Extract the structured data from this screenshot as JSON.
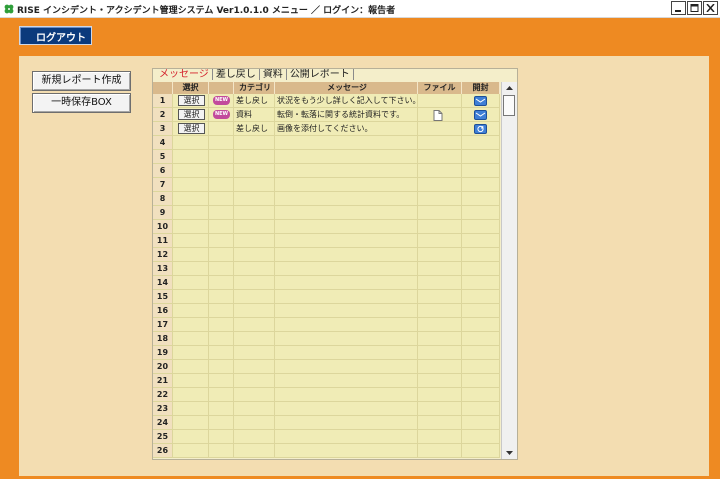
{
  "window": {
    "title": "RISE インシデント・アクシデント管理システム Ver1.0.1.0 メニュー ／ ログイン：報告者"
  },
  "toolbar": {
    "logout_label": "ログアウト"
  },
  "sidebar": {
    "new_report_label": "新規レポート作成",
    "temp_box_label": "一時保存BOX"
  },
  "tabs": [
    {
      "label": "メッセージ",
      "active": true
    },
    {
      "label": "差し戻し",
      "active": false
    },
    {
      "label": "資料",
      "active": false
    },
    {
      "label": "公開レポート",
      "active": false
    }
  ],
  "table": {
    "headers": [
      "",
      "選択",
      "",
      "カテゴリ",
      "メッセージ",
      "ファイル",
      "開封"
    ],
    "select_label": "選択",
    "new_badge": "NEW",
    "rows": [
      {
        "num": "1",
        "new": true,
        "category": "差し戻し",
        "message": "状況をもう少し詳しく記入して下さい。",
        "file": false,
        "check": "mail-opened"
      },
      {
        "num": "2",
        "new": true,
        "category": "資料",
        "message": "転倒・転落に関する統計資料です。",
        "file": true,
        "check": "mail-opened"
      },
      {
        "num": "3",
        "new": false,
        "category": "差し戻し",
        "message": "画像を添付してください。",
        "file": false,
        "check": "refresh"
      },
      {
        "num": "4"
      },
      {
        "num": "5"
      },
      {
        "num": "6"
      },
      {
        "num": "7"
      },
      {
        "num": "8"
      },
      {
        "num": "9"
      },
      {
        "num": "10"
      },
      {
        "num": "11"
      },
      {
        "num": "12"
      },
      {
        "num": "13"
      },
      {
        "num": "14"
      },
      {
        "num": "15"
      },
      {
        "num": "16"
      },
      {
        "num": "17"
      },
      {
        "num": "18"
      },
      {
        "num": "19"
      },
      {
        "num": "20"
      },
      {
        "num": "21"
      },
      {
        "num": "22"
      },
      {
        "num": "23"
      },
      {
        "num": "24"
      },
      {
        "num": "25"
      },
      {
        "num": "26"
      }
    ]
  },
  "colors": {
    "frame": "#ee8a22",
    "content_bg": "#f3ddb1",
    "header_bg": "#d9b98c",
    "row_bg": "#f0ecb6",
    "logout_bg": "#0b3a7c",
    "active_tab": "#d3202b"
  },
  "icons": {
    "app": "clover-icon",
    "file": "document-icon",
    "check_open": "envelope-icon",
    "check_refresh": "refresh-icon"
  }
}
